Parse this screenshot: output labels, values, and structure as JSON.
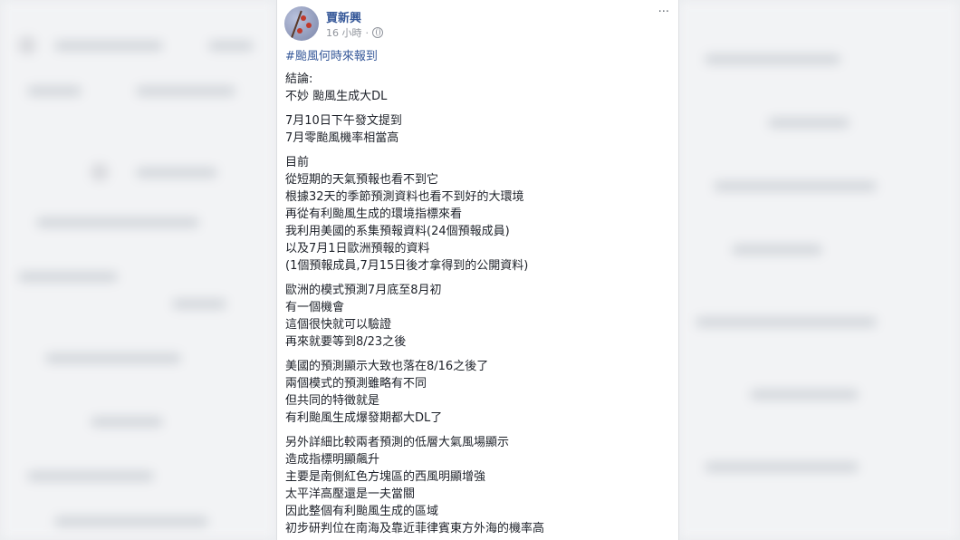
{
  "post": {
    "author": "賈新興",
    "time": "16 小時",
    "separator": "·",
    "more_icon": "···",
    "hashtag": "#颱風何時來報到",
    "paragraphs": [
      [
        "結論:",
        "不妙 颱風生成大DL"
      ],
      [
        "7月10日下午發文提到",
        "7月零颱風機率相當高"
      ],
      [
        "目前",
        "從短期的天氣預報也看不到它",
        "根據32天的季節預測資料也看不到好的大環境",
        "再從有利颱風生成的環境指標來看",
        "我利用美國的系集預報資料(24個預報成員)",
        "以及7月1日歐洲預報的資料",
        "(1個預報成員,7月15日後才拿得到的公開資料)"
      ],
      [
        "歐洲的模式預測7月底至8月初",
        "有一個機會",
        "這個很快就可以驗證",
        "再來就要等到8/23之後"
      ],
      [
        "美國的預測顯示大致也落在8/16之後了",
        "兩個模式的預測雖略有不同",
        "但共同的特徵就是",
        "有利颱風生成爆發期都大DL了"
      ],
      [
        "另外詳細比較兩者預測的低層大氣風場顯示",
        "造成指標明顯飆升",
        "主要是南側紅色方塊區的西風明顯增強",
        "太平洋高壓還是一夫當關",
        "因此整個有利颱風生成的區域",
        "初步研判位在南海及靠近菲律賓東方外海的機率高"
      ]
    ]
  }
}
